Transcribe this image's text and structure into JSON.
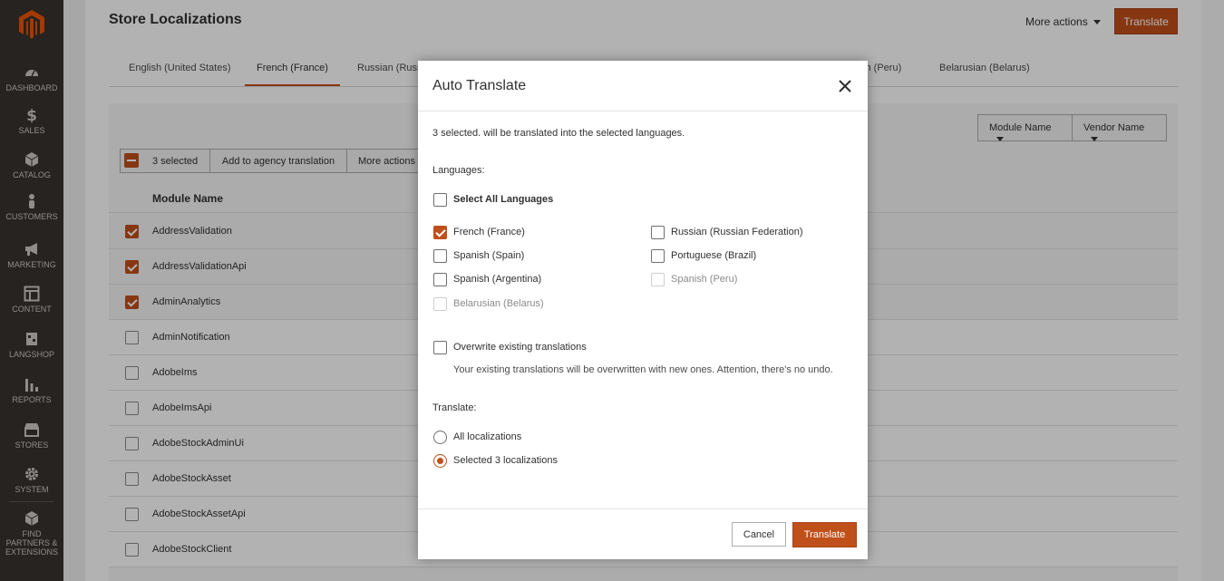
{
  "sidebar": {
    "logo": "magento-logo",
    "items": [
      {
        "label": "DASHBOARD",
        "icon": "dashboard-icon"
      },
      {
        "label": "SALES",
        "icon": "dollar-icon"
      },
      {
        "label": "CATALOG",
        "icon": "box-icon"
      },
      {
        "label": "CUSTOMERS",
        "icon": "person-icon"
      },
      {
        "label": "MARKETING",
        "icon": "megaphone-icon"
      },
      {
        "label": "CONTENT",
        "icon": "layout-icon"
      },
      {
        "label": "LANGSHOP",
        "icon": "langshop-icon"
      },
      {
        "label": "REPORTS",
        "icon": "bar-chart-icon"
      },
      {
        "label": "STORES",
        "icon": "storefront-icon"
      },
      {
        "label": "SYSTEM",
        "icon": "gear-icon"
      },
      {
        "label": "FIND PARTNERS & EXTENSIONS",
        "icon": "cube-icon"
      }
    ]
  },
  "header": {
    "title": "Store Localizations",
    "more_actions": "More actions",
    "translate": "Translate"
  },
  "tabs": [
    "English (United States)",
    "French (France)",
    "Russian (Russ",
    "sh (Peru)",
    "Belarusian (Belarus)"
  ],
  "filters": {
    "module_name": "Module Name",
    "vendor_name": "Vendor Name"
  },
  "massaction": {
    "selected": "3 selected",
    "add_agency": "Add to agency translation",
    "more_actions": "More actions"
  },
  "grid": {
    "column": "Module Name",
    "rows": [
      {
        "name": "AddressValidation",
        "checked": true
      },
      {
        "name": "AddressValidationApi",
        "checked": true
      },
      {
        "name": "AdminAnalytics",
        "checked": true
      },
      {
        "name": "AdminNotification",
        "checked": false
      },
      {
        "name": "AdobeIms",
        "checked": false
      },
      {
        "name": "AdobeImsApi",
        "checked": false
      },
      {
        "name": "AdobeStockAdminUi",
        "checked": false
      },
      {
        "name": "AdobeStockAsset",
        "checked": false
      },
      {
        "name": "AdobeStockAssetApi",
        "checked": false
      },
      {
        "name": "AdobeStockClient",
        "checked": false
      }
    ]
  },
  "modal": {
    "title": "Auto Translate",
    "intro": "3 selected. will be translated into the selected languages.",
    "languages_label": "Languages:",
    "select_all": "Select All Languages",
    "languages": [
      {
        "label": "French (France)",
        "checked": true,
        "disabled": false
      },
      {
        "label": "Russian (Russian Federation)",
        "checked": false,
        "disabled": false
      },
      {
        "label": "Spanish (Spain)",
        "checked": false,
        "disabled": false
      },
      {
        "label": "Portuguese (Brazil)",
        "checked": false,
        "disabled": false
      },
      {
        "label": "Spanish (Argentina)",
        "checked": false,
        "disabled": false
      },
      {
        "label": "Spanish (Peru)",
        "checked": false,
        "disabled": true
      },
      {
        "label": "Belarusian (Belarus)",
        "checked": false,
        "disabled": true
      }
    ],
    "overwrite_label": "Overwrite existing translations",
    "overwrite_desc": "Your existing translations will be overwritten with new ones. Attention, there's no undo.",
    "translate_label": "Translate:",
    "scope_all": "All localizations",
    "scope_selected": "Selected 3 localizations",
    "cancel": "Cancel",
    "submit": "Translate"
  },
  "colors": {
    "accent": "#c0501a",
    "sidebar": "#373330"
  }
}
